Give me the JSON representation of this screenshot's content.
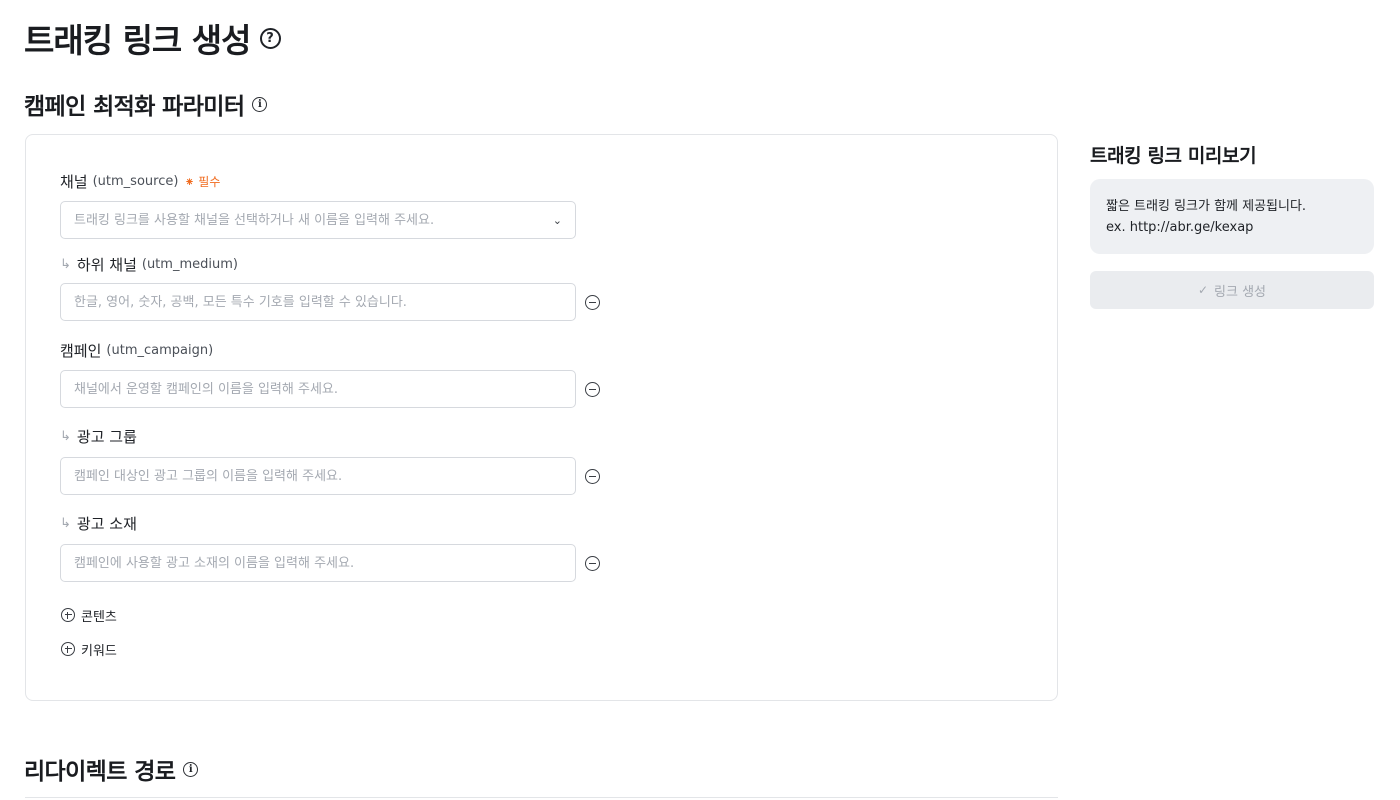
{
  "page": {
    "title": "트래킹 링크 생성",
    "help_icon": "question-circle-icon"
  },
  "campaign_section": {
    "title": "캠페인 최적화 파라미터",
    "info_icon": "info-circle-icon",
    "fields": [
      {
        "label": "채널",
        "param": "(utm_source)",
        "required": "⁕ 필수",
        "placeholder": "트래킹 링크를 사용할 채널을 선택하거나 새 이름을 입력해 주세요.",
        "value": "",
        "type": "select"
      },
      {
        "sub_marker": "↳",
        "label": "하위 채널",
        "param": "(utm_medium)",
        "placeholder": "한글, 영어, 숫자, 공백, 모든 특수 기호를 입력할 수 있습니다.",
        "value": ""
      },
      {
        "label": "캠페인",
        "param": "(utm_campaign)",
        "placeholder": "채널에서 운영할 캠페인의 이름을 입력해 주세요.",
        "value": ""
      },
      {
        "sub_marker": "↳",
        "label": "광고 그룹",
        "placeholder": "캠페인 대상인 광고 그룹의 이름을 입력해 주세요.",
        "value": ""
      },
      {
        "sub_marker": "↳",
        "label": "광고 소재",
        "placeholder": "캠페인에 사용할 광고 소재의 이름을 입력해 주세요.",
        "value": ""
      }
    ],
    "add_items": [
      "콘텐츠",
      "키워드"
    ]
  },
  "preview": {
    "title": "트래킹 링크 미리보기",
    "description": "짧은 트래킹 링크가 함께 제공됩니다.",
    "example": "ex. http://abr.ge/kexap",
    "button_check": "✓",
    "button_label": "링크 생성"
  },
  "redirect_section": {
    "title": "리다이렉트 경로",
    "info_icon": "info-circle-icon"
  },
  "colors": {
    "required_accent": "#f06a1d",
    "preview_background": "#eef0f3",
    "disabled_button": "#eaecef"
  }
}
